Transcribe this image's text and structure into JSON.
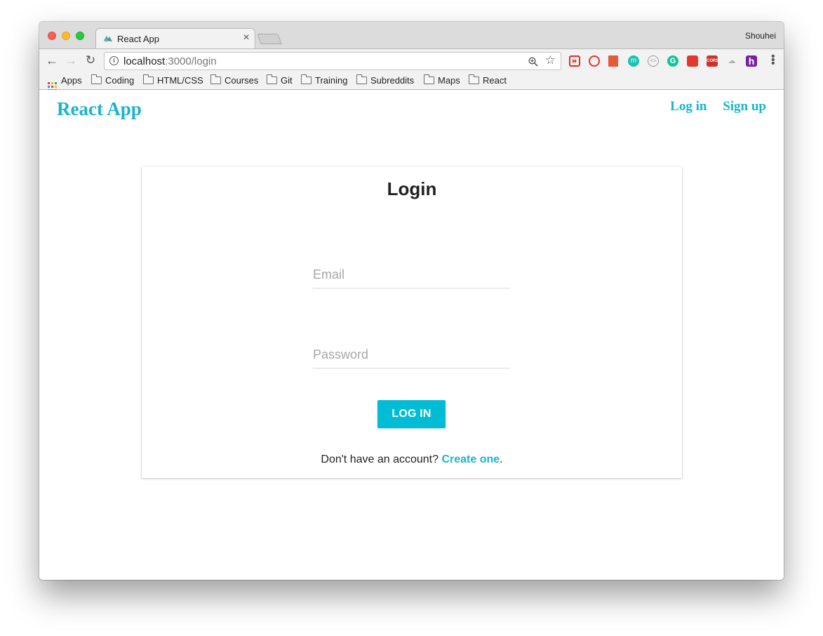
{
  "browser": {
    "tab_title": "React App",
    "tab_close": "×",
    "profile_name": "Shouhei",
    "url_host": "localhost",
    "url_path": ":3000/login",
    "bookmarks": [
      {
        "label": "Apps",
        "icon": "apps-grid-icon"
      },
      {
        "label": "Coding",
        "icon": "folder-icon"
      },
      {
        "label": "HTML/CSS",
        "icon": "folder-icon"
      },
      {
        "label": "Courses",
        "icon": "folder-icon"
      },
      {
        "label": "Git",
        "icon": "folder-icon"
      },
      {
        "label": "Training",
        "icon": "folder-icon"
      },
      {
        "label": "Subreddits",
        "icon": "folder-icon"
      },
      {
        "label": "Maps",
        "icon": "folder-icon"
      },
      {
        "label": "React",
        "icon": "folder-icon"
      }
    ],
    "extensions": [
      {
        "name": "video-extension-icon",
        "color": "#d93025"
      },
      {
        "name": "opera-extension-icon",
        "color": "#e8332a"
      },
      {
        "name": "book-extension-icon",
        "color": "#e25c3b"
      },
      {
        "name": "m-extension-icon",
        "color": "#17c3b2"
      },
      {
        "name": "code-extension-icon",
        "color": "#9a9a9a"
      },
      {
        "name": "grammarly-extension-icon",
        "color": "#15c39a"
      },
      {
        "name": "bug-extension-icon",
        "color": "#e03a2f"
      },
      {
        "name": "cors-extension-icon",
        "color": "#d0302a"
      },
      {
        "name": "cloud-extension-icon",
        "color": "#b0b0b0"
      },
      {
        "name": "h-extension-icon",
        "color": "#7b1fa2"
      }
    ]
  },
  "app": {
    "brand": "React App",
    "nav_login": "Log in",
    "nav_signup": "Sign up",
    "accent_color": "#00bcd4"
  },
  "login": {
    "title": "Login",
    "email_placeholder": "Email",
    "email_value": "",
    "password_placeholder": "Password",
    "password_value": "",
    "button_label": "LOG IN",
    "signup_prompt": "Don't have an account? ",
    "signup_link": "Create one",
    "signup_suffix": "."
  }
}
